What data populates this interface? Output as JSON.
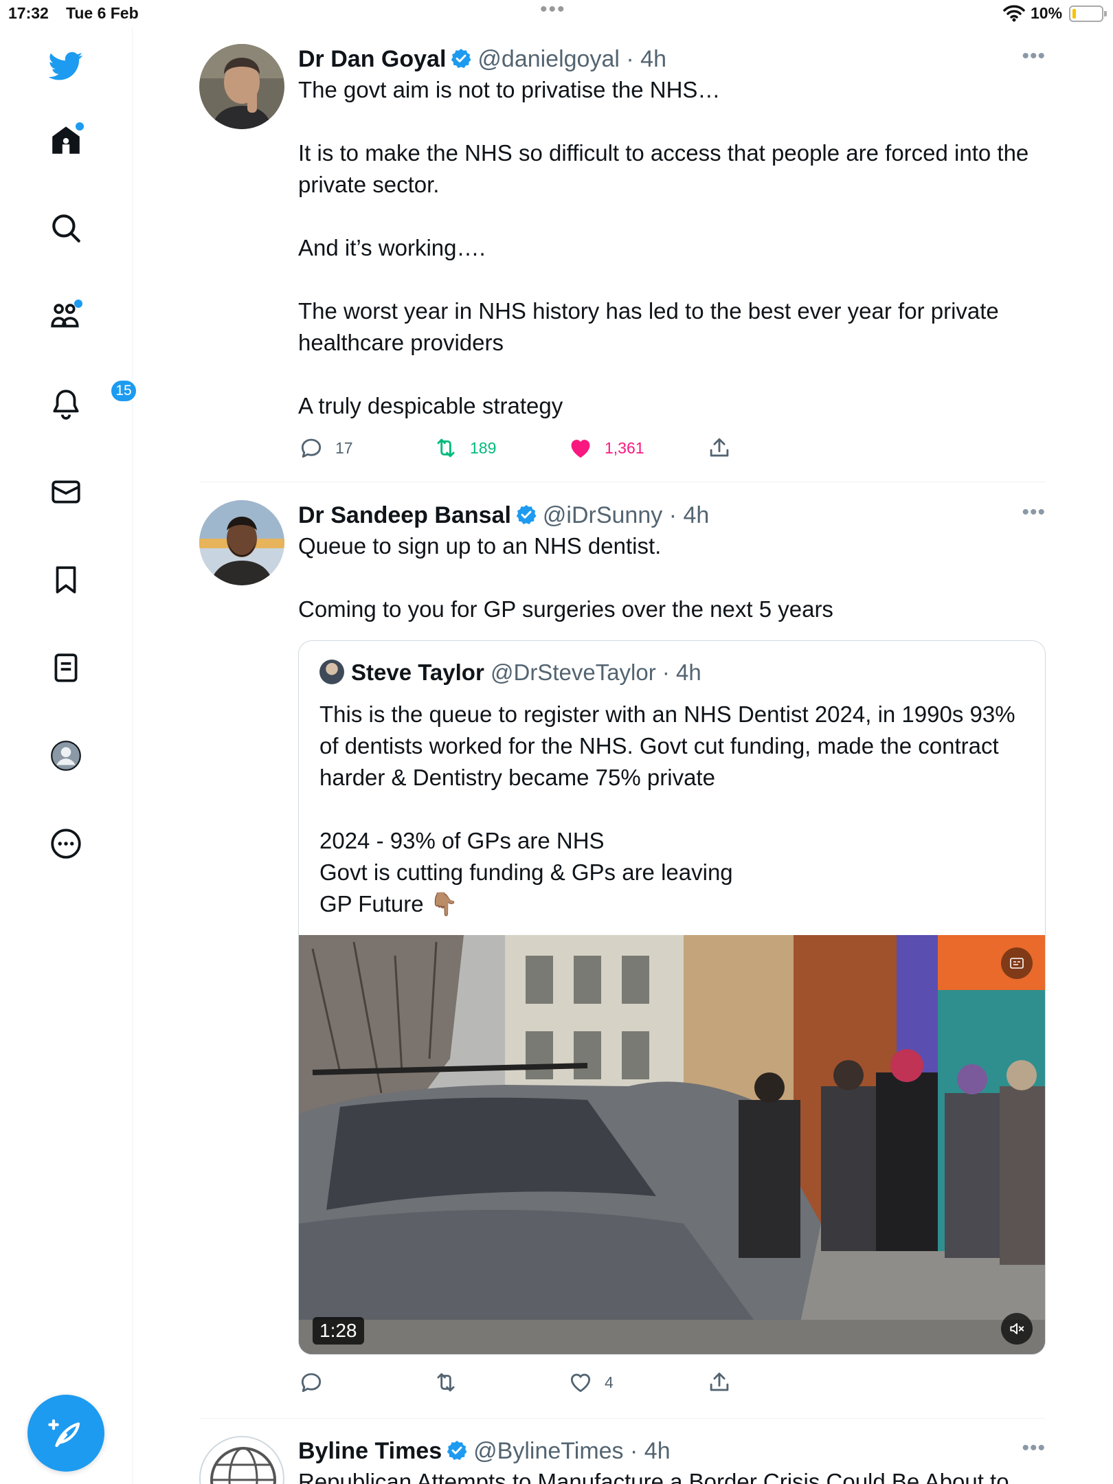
{
  "status_bar": {
    "time": "17:32",
    "date": "Tue 6 Feb",
    "battery_percent": "10%",
    "battery_level": 0.1
  },
  "sidebar": {
    "items": [
      {
        "icon": "twitter-logo-icon"
      },
      {
        "icon": "home-icon",
        "has_dot": true
      },
      {
        "icon": "search-icon"
      },
      {
        "icon": "communities-icon",
        "has_dot": true
      },
      {
        "icon": "bell-icon",
        "badge": "15"
      },
      {
        "icon": "mail-icon"
      },
      {
        "icon": "bookmark-icon"
      },
      {
        "icon": "lists-icon"
      },
      {
        "icon": "profile-icon"
      },
      {
        "icon": "more-circle-icon"
      }
    ],
    "compose_icon": "compose-feather-icon"
  },
  "colors": {
    "accent": "#1d9bf0",
    "like": "#f91880",
    "retweet": "#00ba7c",
    "secondary_text": "#536471"
  },
  "feed": [
    {
      "name": "Dr Dan Goyal",
      "handle": "@danielgoyal",
      "separator": "·",
      "age": "4h",
      "verified": true,
      "text": "The govt aim is not to privatise the NHS…\n\nIt is to make the NHS so difficult to access that people are forced into the private sector.\n\nAnd it’s working….\n\nThe worst year in NHS history has led to the best ever year for private healthcare providers\n\nA truly despicable strategy",
      "replies": "17",
      "retweets": "189",
      "likes": "1,361",
      "liked": true
    },
    {
      "name": "Dr Sandeep Bansal",
      "handle": "@iDrSunny",
      "separator": "·",
      "age": "4h",
      "verified": true,
      "text": "Queue to sign up to an NHS dentist.\n\nComing to you for GP surgeries over the next 5 years",
      "quote": {
        "name": "Steve Taylor",
        "handle": "@DrSteveTaylor",
        "separator": "·",
        "age": "4h",
        "text": "This is the queue to register with an NHS Dentist 2024, in 1990s 93% of dentists worked for the NHS. Govt cut funding, made the contract harder & Dentistry became 75% private\n\n2024 - 93% of GPs are NHS\nGovt is cutting funding & GPs are leaving\nGP Future 👇🏽",
        "video_duration": "1:28"
      },
      "replies": "",
      "retweets": "",
      "likes": "4",
      "liked": false
    },
    {
      "name": "Byline Times",
      "handle": "@BylineTimes",
      "separator": "·",
      "age": "4h",
      "verified": true,
      "text": "Republican Attempts to Manufacture a Border Crisis Could Be About to"
    }
  ]
}
